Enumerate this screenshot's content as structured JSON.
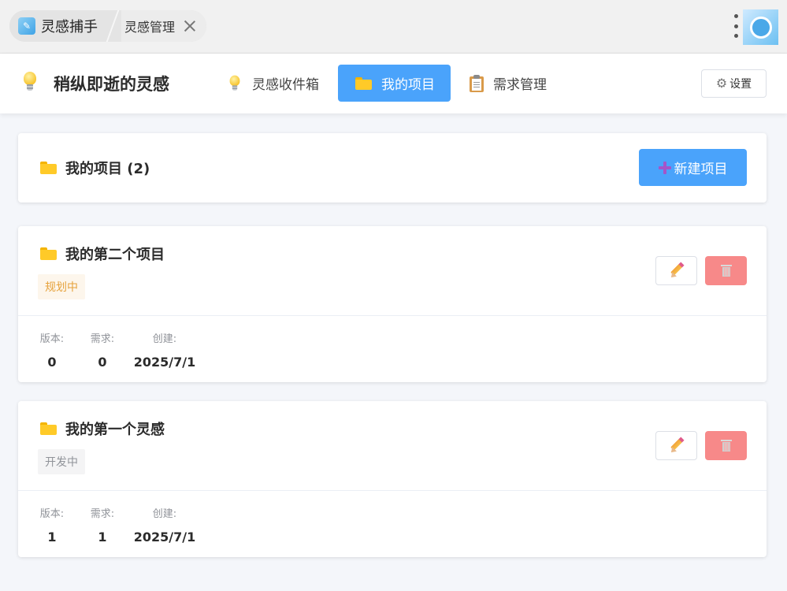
{
  "window": {
    "app_tab_title": "灵感捕手",
    "sub_tab_title": "灵感管理",
    "avatar_icon": "app-avatar-icon"
  },
  "header": {
    "brand_title": "稍纵即逝的灵感",
    "nav": [
      {
        "label": "灵感收件箱",
        "icon": "lightbulb-icon",
        "active": false
      },
      {
        "label": "我的项目",
        "icon": "folder-icon",
        "active": true
      },
      {
        "label": "需求管理",
        "icon": "clipboard-icon",
        "active": false
      }
    ],
    "settings_label": "设置"
  },
  "summary": {
    "title": "我的项目 (2)",
    "new_button_label": "新建项目"
  },
  "stat_labels": {
    "version": "版本:",
    "requirements": "需求:",
    "created": "创建:"
  },
  "projects": [
    {
      "name": "我的第二个项目",
      "status": "规划中",
      "status_color": "#e6a23c",
      "version": "0",
      "requirements": "0",
      "created": "2025/7/1"
    },
    {
      "name": "我的第一个灵感",
      "status": "开发中",
      "status_color": "#909399",
      "version": "1",
      "requirements": "1",
      "created": "2025/7/1"
    }
  ],
  "colors": {
    "primary": "#4aa3fb",
    "danger": "#f78989",
    "background": "#f4f6fa"
  }
}
